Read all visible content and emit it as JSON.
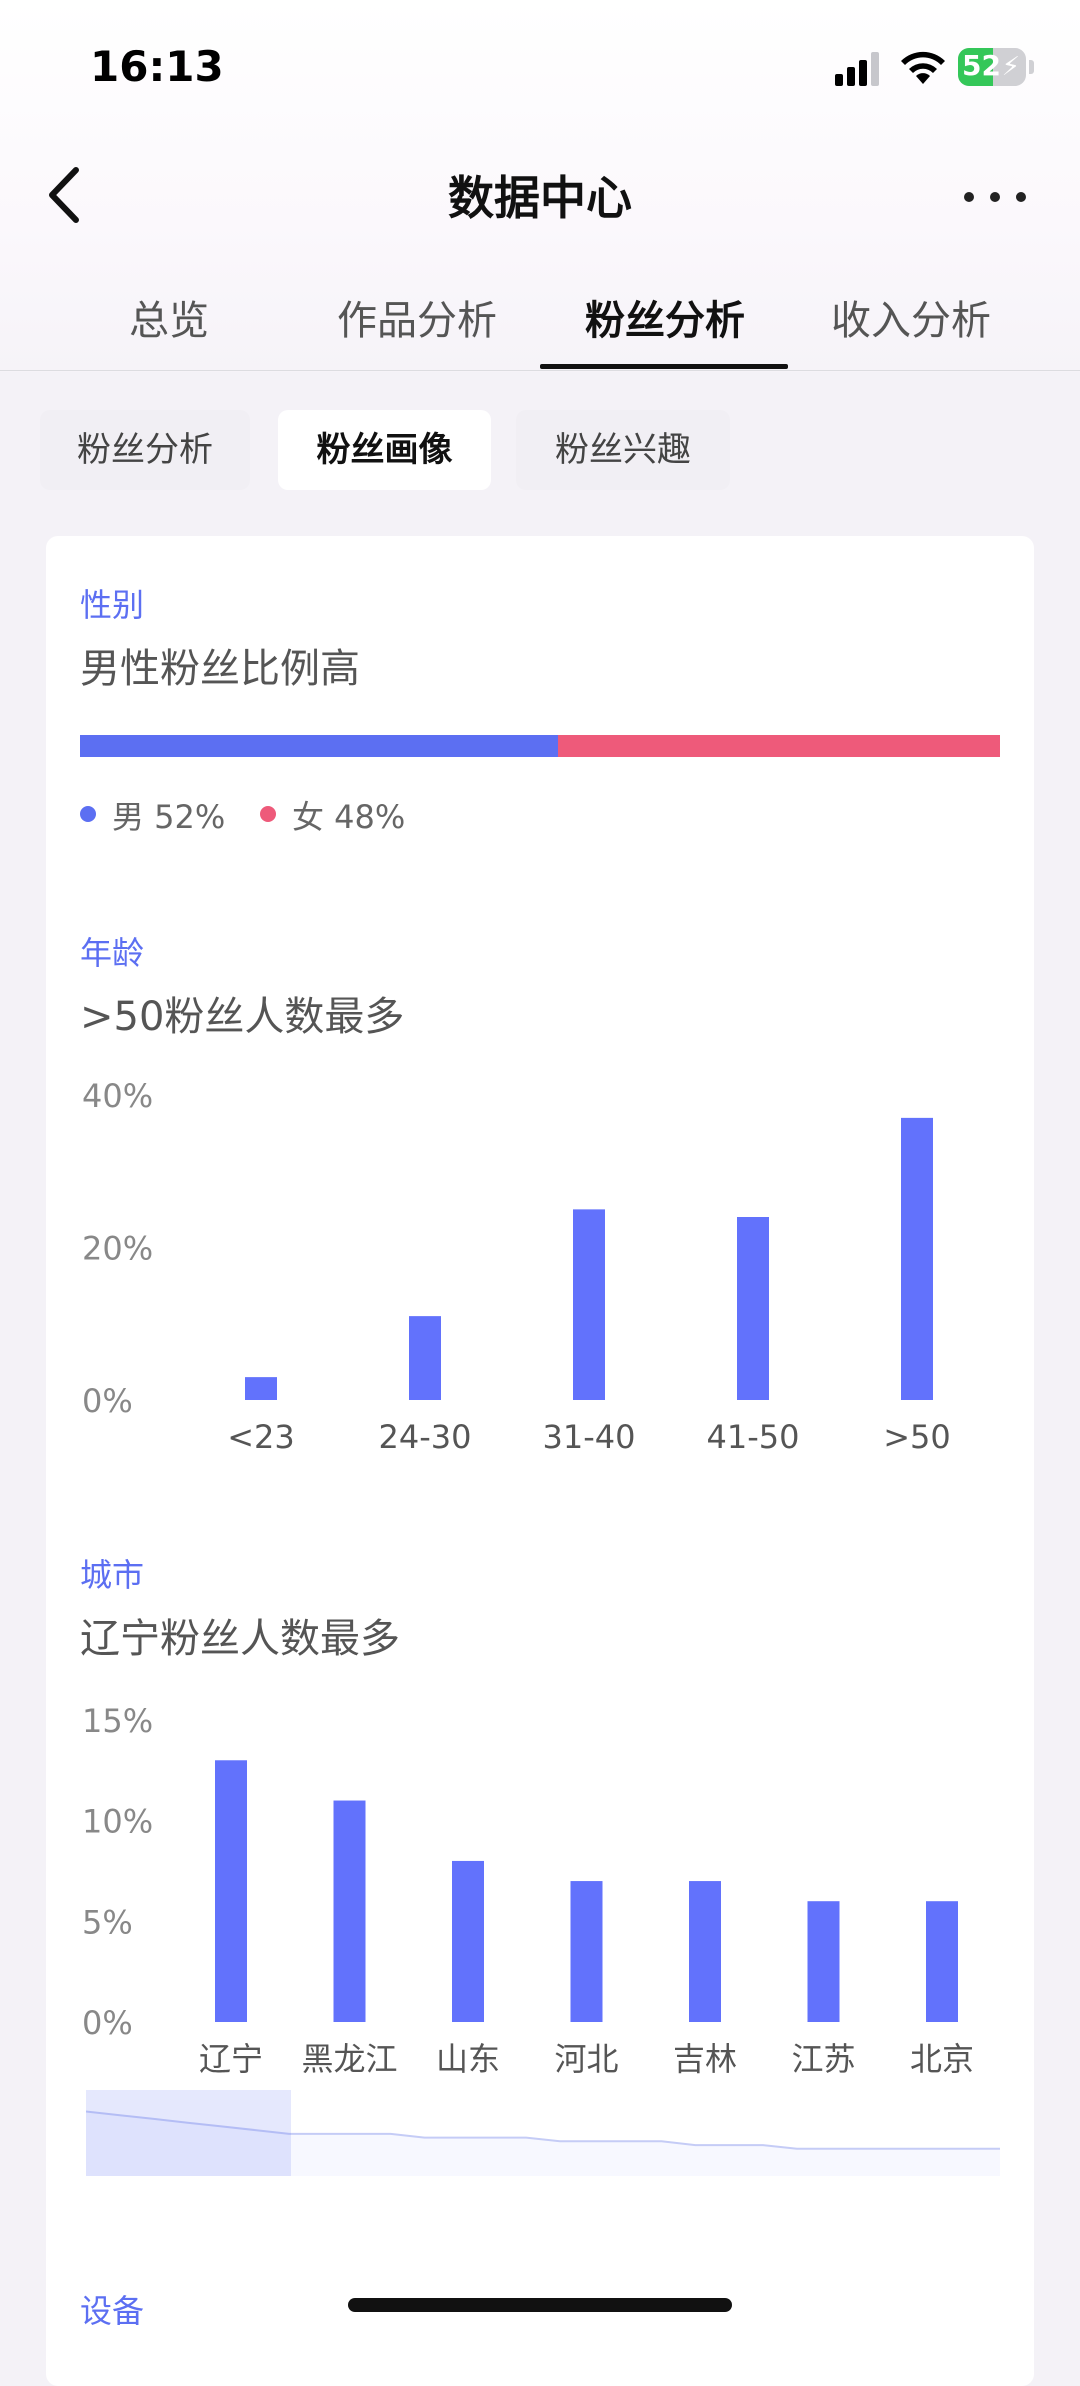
{
  "status_bar": {
    "time": "16:13",
    "battery": "52",
    "battery_level": 0.52
  },
  "nav": {
    "title": "数据中心"
  },
  "main_tabs": [
    {
      "label": "总览"
    },
    {
      "label": "作品分析"
    },
    {
      "label": "粉丝分析"
    },
    {
      "label": "收入分析"
    }
  ],
  "active_main_tab": 2,
  "sub_tabs": [
    {
      "label": "粉丝分析"
    },
    {
      "label": "粉丝画像"
    },
    {
      "label": "粉丝兴趣"
    }
  ],
  "active_sub_tab": 1,
  "gender": {
    "label": "性别",
    "title": "男性粉丝比例高",
    "male_ratio": 0.52,
    "male_legend": "男 52%",
    "female_legend": "女 48%",
    "male_color": "#5c6ff2",
    "female_color": "#ee5a7a"
  },
  "age": {
    "label": "年龄",
    "title": ">50粉丝人数最多"
  },
  "city": {
    "label": "城市",
    "title": "辽宁粉丝人数最多"
  },
  "device": {
    "label": "设备"
  },
  "chart_data": [
    {
      "type": "bar",
      "categories": [
        "<23",
        "24-30",
        "31-40",
        "41-50",
        ">50"
      ],
      "values": [
        3,
        11,
        25,
        24,
        37
      ],
      "ylim": [
        0,
        40
      ],
      "yticks": [
        "0%",
        "20%",
        "40%"
      ],
      "ytick_values": [
        0,
        20,
        40
      ],
      "grid": false,
      "color": "#6272fc"
    },
    {
      "type": "bar",
      "categories": [
        "辽宁",
        "黑龙江",
        "山东",
        "河北",
        "吉林",
        "江苏",
        "北京"
      ],
      "values": [
        13,
        11,
        8,
        7,
        7,
        6,
        6
      ],
      "ylim": [
        0,
        15
      ],
      "yticks": [
        "0%",
        "5%",
        "10%",
        "15%"
      ],
      "ytick_values": [
        0,
        5,
        10,
        15
      ],
      "grid": false,
      "color": "#6272fc",
      "overview_values": [
        13,
        12,
        11,
        10,
        9,
        8,
        7,
        7,
        7,
        7,
        6,
        6,
        6,
        6,
        5,
        5,
        5,
        5,
        4,
        4,
        4,
        3,
        3,
        3,
        3,
        3,
        3,
        3
      ]
    }
  ]
}
